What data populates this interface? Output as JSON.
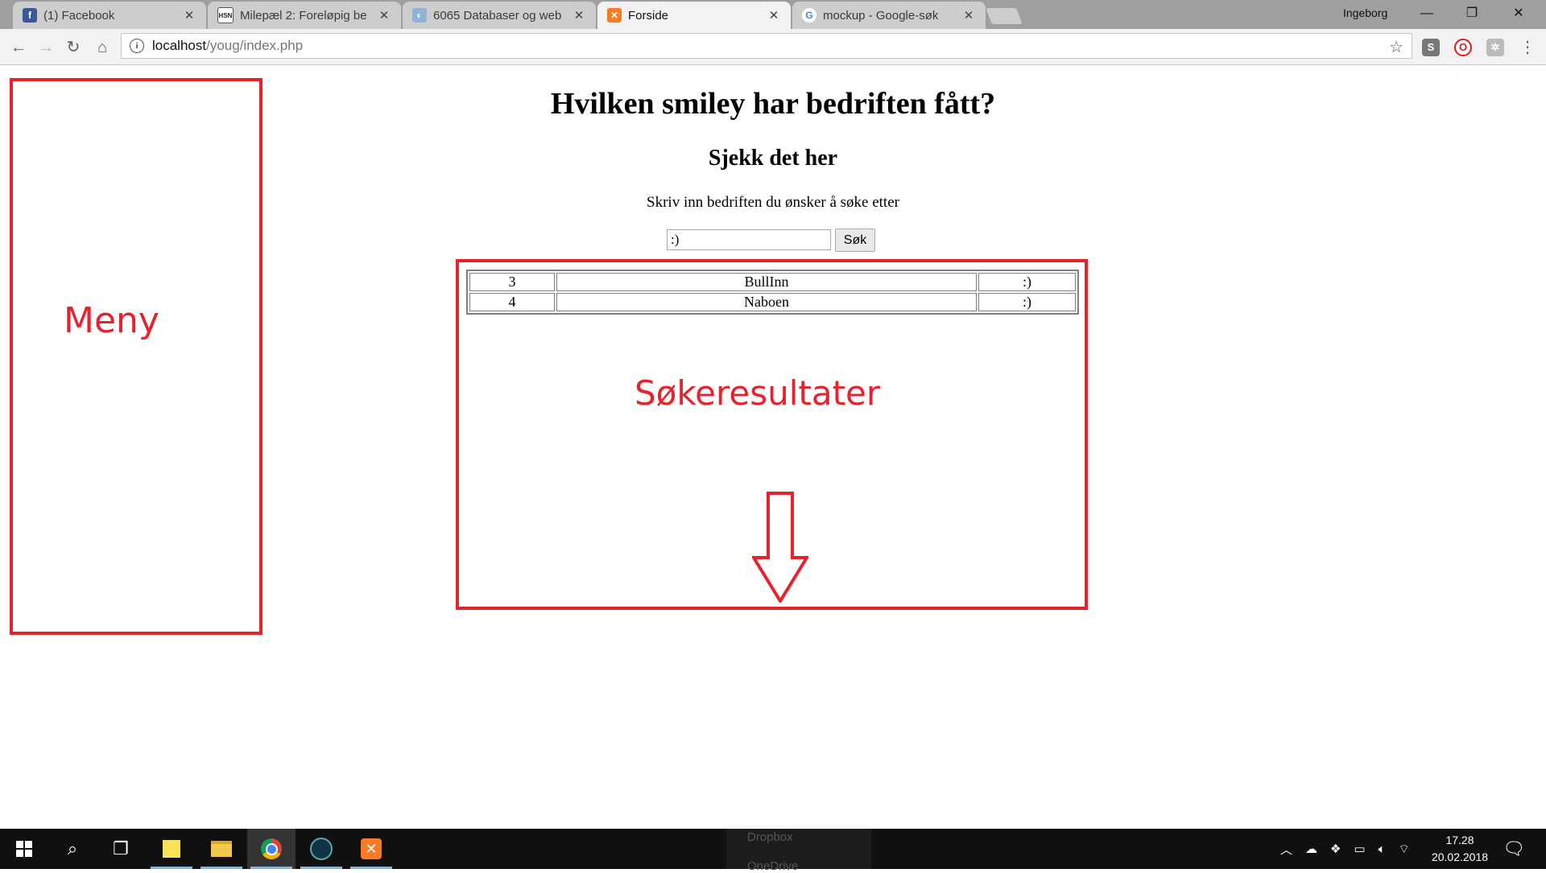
{
  "browser": {
    "tabs": [
      {
        "label": "(1) Facebook",
        "icon": "facebook-icon",
        "active": false
      },
      {
        "label": "Milepæl 2: Foreløpig be",
        "icon": "hsn-icon",
        "active": false
      },
      {
        "label": "6065 Databaser og web",
        "icon": "web-icon",
        "active": false
      },
      {
        "label": "Forside",
        "icon": "xampp-icon",
        "active": true
      },
      {
        "label": "mockup - Google-søk",
        "icon": "google-icon",
        "active": false
      }
    ],
    "profile_name": "Ingeborg",
    "url_host": "localhost",
    "url_path": "/youg/index.php",
    "extensions": [
      "S",
      "O"
    ]
  },
  "page": {
    "heading": "Hvilken smiley har bedriften fått?",
    "subheading": "Sjekk det her",
    "instruction": "Skriv inn bedriften du ønsker å søke etter",
    "search": {
      "value": ":)",
      "button_label": "Søk"
    },
    "results": [
      {
        "id": "3",
        "name": "BullInn",
        "smiley": ":)"
      },
      {
        "id": "4",
        "name": "Naboen",
        "smiley": ":)"
      }
    ],
    "annotations": {
      "menu_label": "Meny",
      "results_label": "Søkeresultater",
      "color": "#e8222d"
    }
  },
  "taskbar": {
    "ghost_label_1": "Dropbox",
    "ghost_label_2": "OneDrive",
    "time": "17.28",
    "date": "20.02.2018"
  }
}
